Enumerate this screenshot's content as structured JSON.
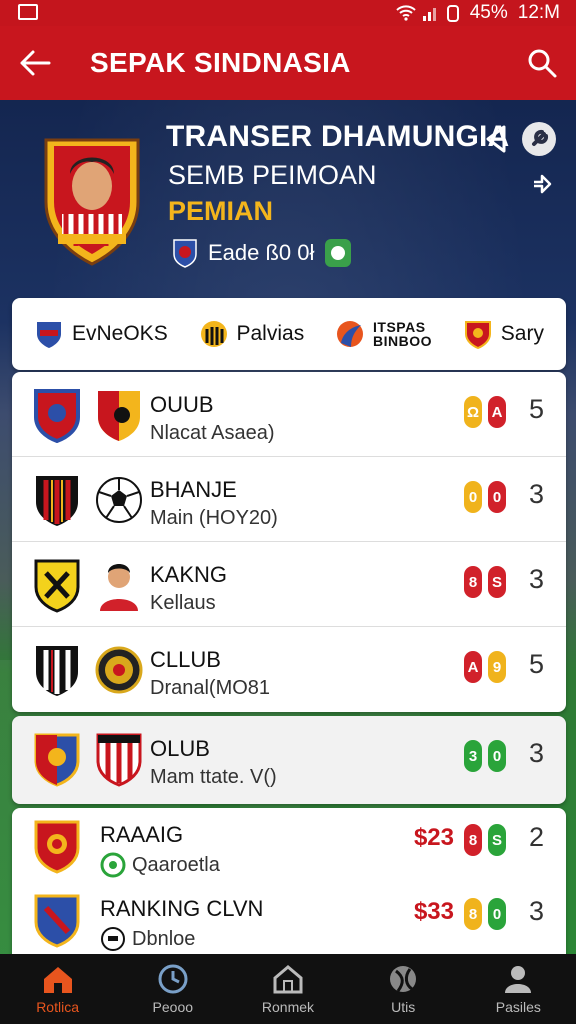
{
  "status_bar": {
    "battery": "45%",
    "time": "12:M"
  },
  "app_bar": {
    "title": "SEPAK SINDNASIA"
  },
  "hero": {
    "line1": "TRANSER DHAMUNGIA",
    "line2": "SEMB PEIMOAN",
    "line3": "PEMIAN",
    "sub": "Eade ß0 0ł",
    "colors": {
      "accent": "#f3b51c",
      "brand": "#c8161e"
    }
  },
  "tabs": [
    {
      "label": "EvNeOKS"
    },
    {
      "label": "Palvias"
    },
    {
      "label_top": "ITSPAS",
      "label_bottom": "BINBOO"
    },
    {
      "label": "Sary"
    }
  ],
  "rows": [
    {
      "name": "OUUB",
      "desc": "Nlacat Asaea)",
      "badges": [
        {
          "t": "Ω",
          "c": "#f0b31c"
        },
        {
          "t": "A",
          "c": "#d1212a"
        }
      ],
      "count": "5"
    },
    {
      "name": "BHANJE",
      "desc": "Main (HOY20)",
      "badges": [
        {
          "t": "0",
          "c": "#f0b31c"
        },
        {
          "t": "0",
          "c": "#d1212a"
        }
      ],
      "count": "3"
    },
    {
      "name": "KAKNG",
      "desc": "Kellaus",
      "badges": [
        {
          "t": "8",
          "c": "#d1212a"
        },
        {
          "t": "S",
          "c": "#d1212a"
        }
      ],
      "count": "3"
    },
    {
      "name": "CLLUB",
      "desc": "Dranal(MO81",
      "badges": [
        {
          "t": "A",
          "c": "#d1212a"
        },
        {
          "t": "9",
          "c": "#f0b31c"
        }
      ],
      "count": "5"
    }
  ],
  "highlight_row": {
    "name": "OLUB",
    "desc": "Mam ttate. V()",
    "badges": [
      {
        "t": "3",
        "c": "#2aa43a"
      },
      {
        "t": "0",
        "c": "#2aa43a"
      }
    ],
    "count": "3"
  },
  "bottom_rows": [
    {
      "name": "RAAAIG",
      "desc": "Qaaroetla",
      "money": "$23",
      "badges": [
        {
          "t": "8",
          "c": "#d1212a"
        },
        {
          "t": "S",
          "c": "#2aa43a"
        }
      ],
      "count": "2"
    },
    {
      "name": "RANKING CLVN",
      "desc": "Dbnloe",
      "money": "$33",
      "badges": [
        {
          "t": "8",
          "c": "#f0b31c"
        },
        {
          "t": "0",
          "c": "#2aa43a"
        }
      ],
      "count": "3"
    }
  ],
  "bottom_nav": [
    {
      "label": "Rotlica",
      "icon": "home-icon"
    },
    {
      "label": "Peooo",
      "icon": "clock-icon"
    },
    {
      "label": "Ronmek",
      "icon": "house-outline-icon"
    },
    {
      "label": "Utis",
      "icon": "sports-icon"
    },
    {
      "label": "Pasiles",
      "icon": "profile-icon"
    }
  ]
}
